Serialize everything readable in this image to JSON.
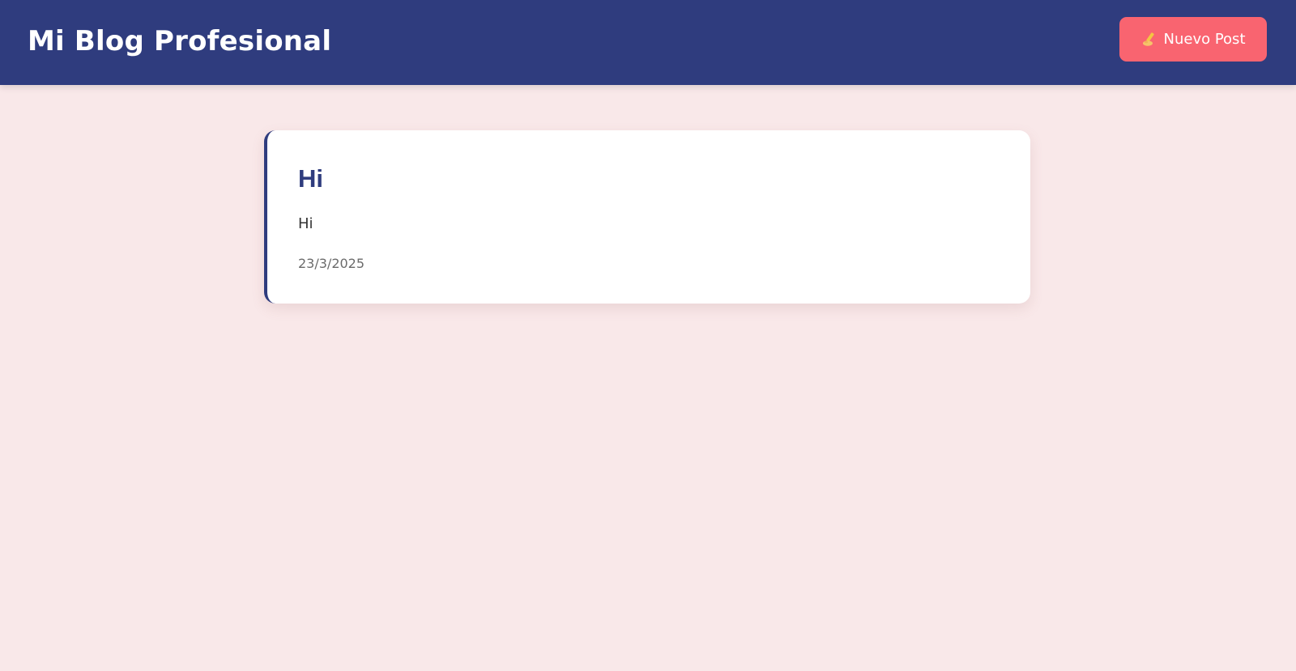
{
  "header": {
    "title": "Mi Blog Profesional",
    "new_post_label": "Nuevo Post",
    "new_post_icon": "writing-hand-icon"
  },
  "colors": {
    "header_bg": "#2f3c7e",
    "accent": "#f96470",
    "page_bg": "#f9e8e9",
    "card_bg": "#ffffff"
  },
  "posts": [
    {
      "title": "Hi",
      "body": "Hi",
      "date": "23/3/2025"
    }
  ]
}
